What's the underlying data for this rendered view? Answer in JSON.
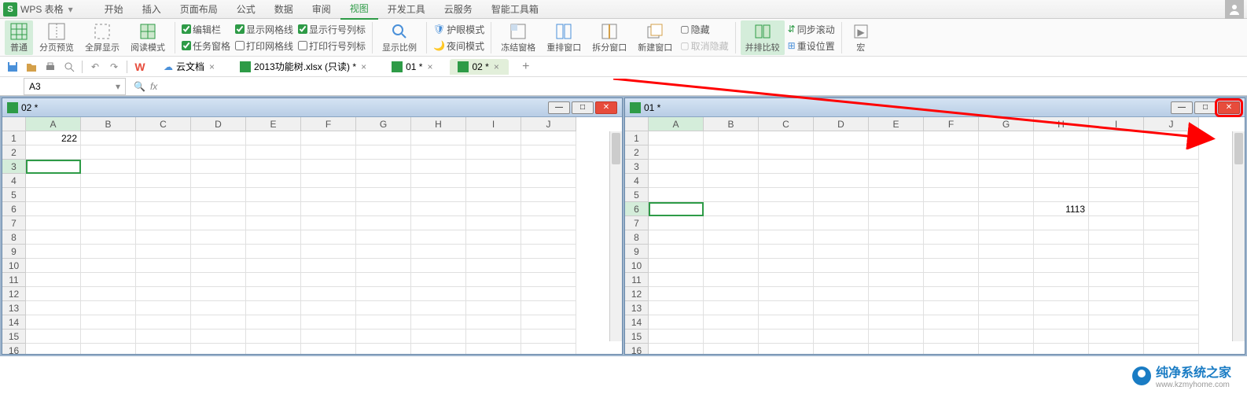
{
  "app": {
    "title": "WPS 表格"
  },
  "menu": {
    "items": [
      "开始",
      "插入",
      "页面布局",
      "公式",
      "数据",
      "审阅",
      "视图",
      "开发工具",
      "云服务",
      "智能工具箱"
    ],
    "active_index": 6
  },
  "ribbon": {
    "view_normal": "普通",
    "view_pagebreak": "分页预览",
    "view_fullscreen": "全屏显示",
    "view_reading": "阅读模式",
    "chk_formula_bar": "编辑栏",
    "chk_task_pane": "任务窗格",
    "chk_gridlines": "显示网格线",
    "chk_print_gridlines": "打印网格线",
    "chk_headings": "显示行号列标",
    "chk_print_headings": "打印行号列标",
    "zoom": "显示比例",
    "eye_protect": "护眼模式",
    "night_mode": "夜间模式",
    "freeze": "冻结窗格",
    "arrange": "重排窗口",
    "split": "拆分窗口",
    "new_window": "新建窗口",
    "hide": "隐藏",
    "unhide_disabled": "取消隐藏",
    "side_by_side": "并排比较",
    "sync_scroll": "同步滚动",
    "reset_pos": "重设位置",
    "macro": "宏"
  },
  "doc_tabs": {
    "cloud": "云文档",
    "items": [
      {
        "label": "2013功能树.xlsx (只读) *"
      },
      {
        "label": "01 *"
      },
      {
        "label": "02 *"
      }
    ],
    "active_index": 2
  },
  "formula_bar": {
    "name_box": "A3",
    "fx": "fx"
  },
  "panes": {
    "left": {
      "title": "02 *",
      "cols": [
        "A",
        "B",
        "C",
        "D",
        "E",
        "F",
        "G",
        "H",
        "I",
        "J"
      ],
      "rows": [
        "1",
        "2",
        "3",
        "4",
        "5",
        "6",
        "7",
        "8",
        "9",
        "10",
        "11",
        "12",
        "13",
        "14",
        "15",
        "16"
      ],
      "selected_cell": {
        "row": 2,
        "col": 0
      },
      "cells": {
        "0,0": "222"
      }
    },
    "right": {
      "title": "01 *",
      "cols": [
        "A",
        "B",
        "C",
        "D",
        "E",
        "F",
        "G",
        "H",
        "I",
        "J"
      ],
      "rows": [
        "1",
        "2",
        "3",
        "4",
        "5",
        "6",
        "7",
        "8",
        "9",
        "10",
        "11",
        "12",
        "13",
        "14",
        "15",
        "16"
      ],
      "selected_cell": {
        "row": 5,
        "col": 0
      },
      "cells": {
        "5,7": "1113"
      }
    }
  },
  "watermark": {
    "title": "纯净系统之家",
    "sub": "www.kzmyhome.com"
  },
  "chart_data": null
}
